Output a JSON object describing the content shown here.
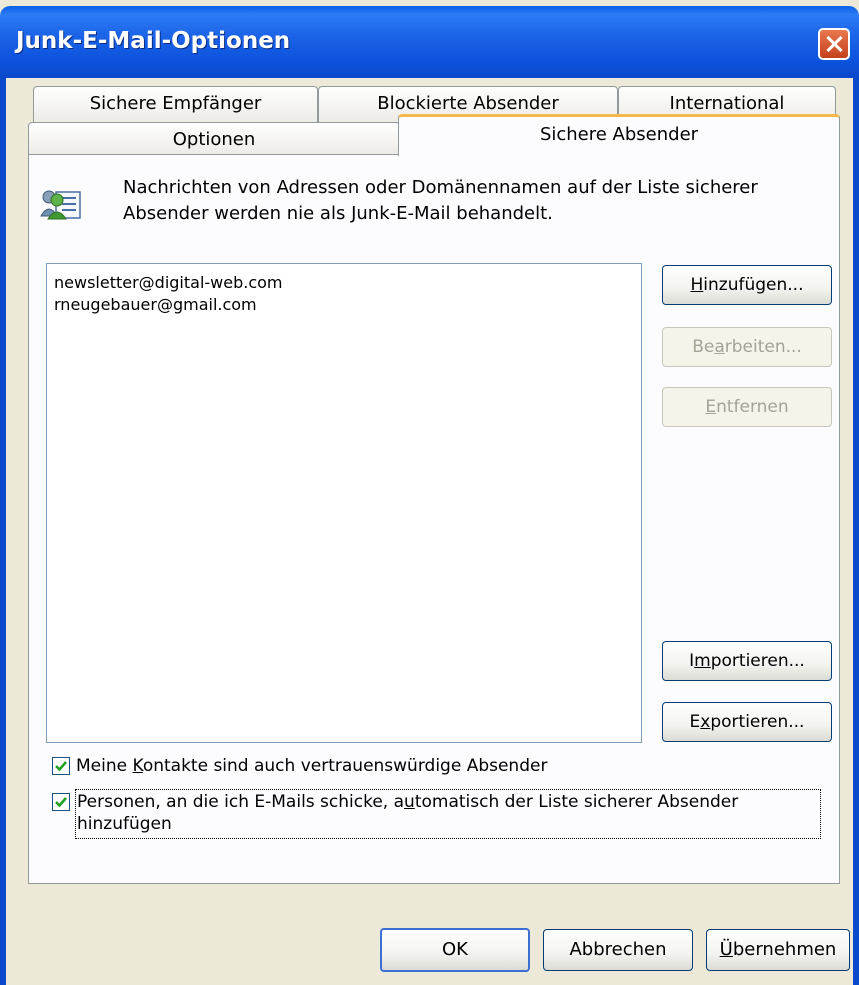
{
  "window": {
    "title": "Junk-E-Mail-Optionen",
    "close_icon": "close-icon"
  },
  "tabs": [
    {
      "id": "sichere-empfaenger",
      "label": "Sichere Empfänger",
      "active": false
    },
    {
      "id": "blockierte-absender",
      "label": "Blockierte Absender",
      "active": false
    },
    {
      "id": "international",
      "label": "International",
      "active": false
    },
    {
      "id": "optionen",
      "label": "Optionen",
      "active": false
    },
    {
      "id": "sichere-absender",
      "label": "Sichere Absender",
      "active": true
    }
  ],
  "panel": {
    "info_icon": "contacts-list-icon",
    "description_line1": "Nachrichten von Adressen oder Domänennamen auf der Liste sicherer",
    "description_line2": "Absender werden nie als Junk-E-Mail behandelt.",
    "list": [
      "newsletter@digital-web.com",
      "rneugebauer@gmail.com"
    ],
    "buttons": {
      "add": {
        "pre": "",
        "key": "H",
        "post": "inzufügen...",
        "enabled": true
      },
      "edit": {
        "pre": "Be",
        "key": "a",
        "post": "rbeiten...",
        "enabled": false
      },
      "remove": {
        "pre": "",
        "key": "E",
        "post": "ntfernen",
        "enabled": false
      },
      "import": {
        "pre": "I",
        "key": "m",
        "post": "portieren...",
        "enabled": true
      },
      "export": {
        "pre": "E",
        "key": "x",
        "post": "portieren...",
        "enabled": true
      }
    },
    "checkbox1": {
      "checked": true,
      "pre": "Meine ",
      "key": "K",
      "post": "ontakte sind auch vertrauenswürdige Absender"
    },
    "checkbox2": {
      "checked": true,
      "pre": "Personen, an die ich E-Mails schicke, a",
      "key": "u",
      "post": "tomatisch der Liste sicherer Absender",
      "line2": "hinzufügen"
    }
  },
  "footer": {
    "ok": "OK",
    "cancel": "Abbrechen",
    "apply_pre": "",
    "apply_key": "Ü",
    "apply_post": "bernehmen"
  },
  "colors": {
    "titlebar": "#0a5fe6",
    "dialog_bg": "#ece9d8",
    "active_tab_accent": "#f7b84c"
  }
}
